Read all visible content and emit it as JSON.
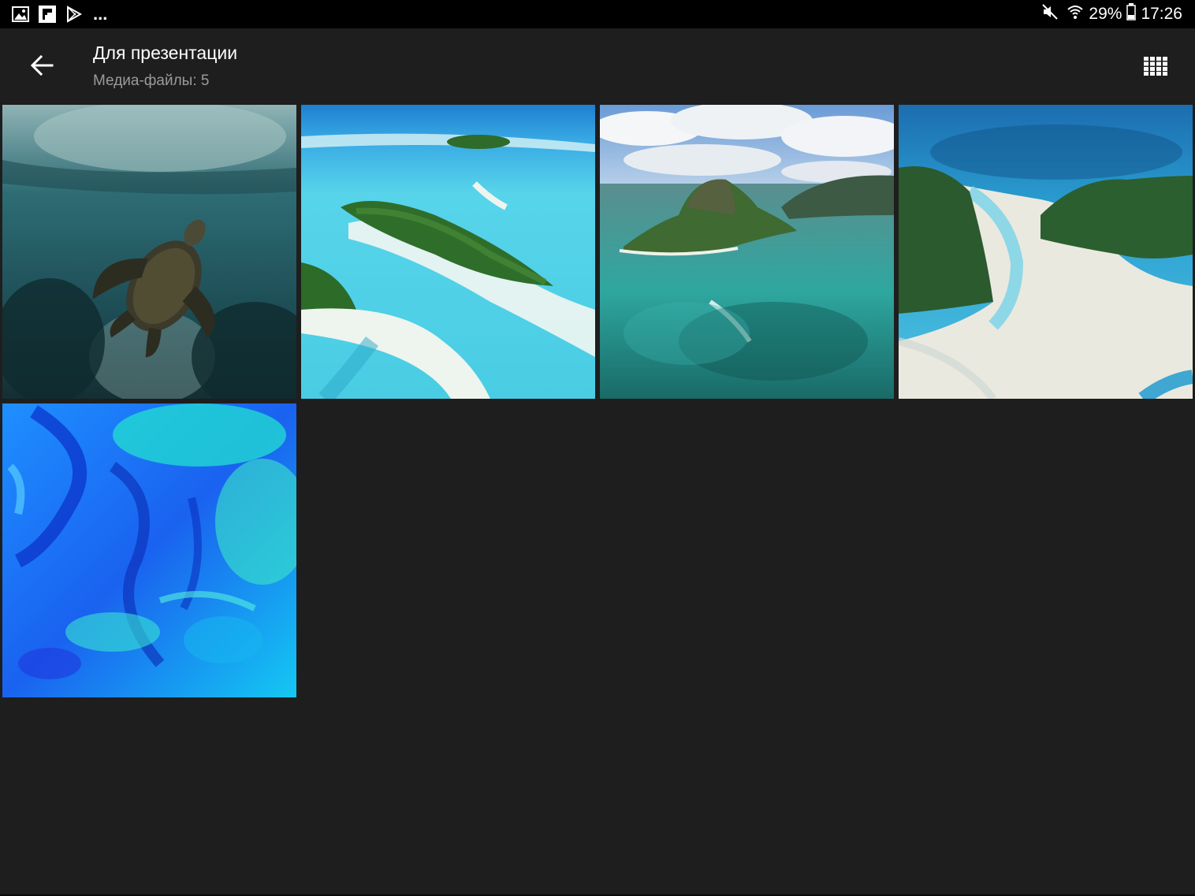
{
  "status_bar": {
    "notification_icons": [
      "gallery-icon",
      "flipboard-icon",
      "play-store-icon"
    ],
    "overflow": "...",
    "mute_icon": "mute-icon",
    "wifi_icon": "wifi-icon",
    "battery_percent": "29%",
    "battery_icon": "battery-icon",
    "time": "17:26"
  },
  "app_bar": {
    "back_icon": "back-arrow-icon",
    "title": "Для презентации",
    "subtitle": "Медиа-файлы: 5",
    "view_toggle_icon": "grid-view-icon"
  },
  "gallery": {
    "items": [
      {
        "name": "photo-sea-turtle",
        "colors": [
          "#2b5a63",
          "#153a40"
        ]
      },
      {
        "name": "photo-aerial-atoll",
        "colors": [
          "#36c8e6",
          "#0a7fb5"
        ]
      },
      {
        "name": "photo-island-mountain",
        "colors": [
          "#5fb5b4",
          "#1e6d6b"
        ]
      },
      {
        "name": "photo-sandbar-island",
        "colors": [
          "#5cc3df",
          "#e9ecea"
        ]
      },
      {
        "name": "photo-blue-abstract",
        "colors": [
          "#1976ff",
          "#10e0e0"
        ]
      }
    ]
  }
}
